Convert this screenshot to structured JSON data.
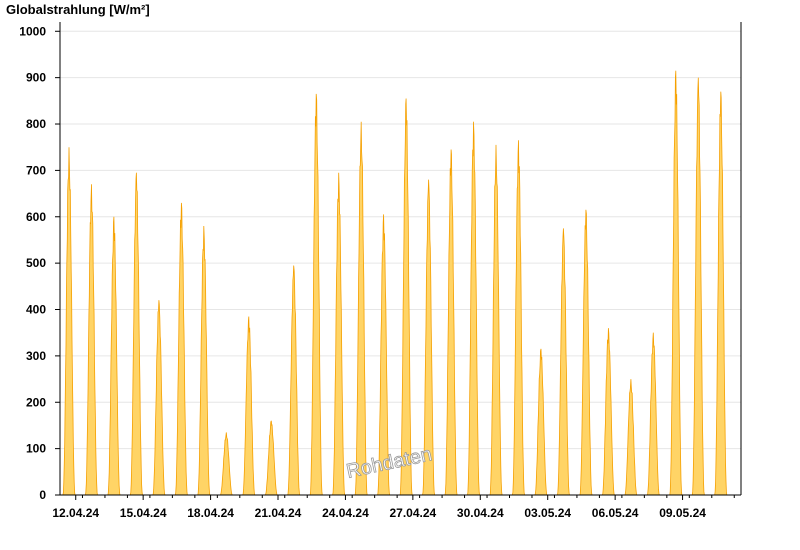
{
  "chart_data": {
    "type": "area",
    "title": "Globalstrahlung [W/m²]",
    "ylabel": "Globalstrahlung [W/m²]",
    "xlabel": "",
    "ylim": [
      0,
      1020
    ],
    "yticks": [
      0,
      100,
      200,
      300,
      400,
      500,
      600,
      700,
      800,
      900,
      1000
    ],
    "xtick_labels": [
      "12.04.24",
      "15.04.24",
      "18.04.24",
      "21.04.24",
      "24.04.24",
      "27.04.24",
      "30.04.24",
      "03.05.24",
      "06.05.24",
      "09.05.24"
    ],
    "xlim_days": [
      0,
      30.3
    ],
    "xtick_day_offsets": [
      0.7,
      3.7,
      6.7,
      9.7,
      12.7,
      15.7,
      18.7,
      21.7,
      24.7,
      27.7
    ],
    "grid": true,
    "watermark": "Rohdaten",
    "color_fill": "#ffd466",
    "color_line": "#f5a000",
    "series": [
      {
        "name": "",
        "daily_peaks": [
          {
            "day": "11.04.24",
            "peak": 750
          },
          {
            "day": "12.04.24",
            "peak": 670
          },
          {
            "day": "13.04.24",
            "peak": 600
          },
          {
            "day": "14.04.24",
            "peak": 695
          },
          {
            "day": "15.04.24",
            "peak": 420
          },
          {
            "day": "16.04.24",
            "peak": 630
          },
          {
            "day": "17.04.24",
            "peak": 580
          },
          {
            "day": "18.04.24",
            "peak": 135
          },
          {
            "day": "19.04.24",
            "peak": 385
          },
          {
            "day": "20.04.24",
            "peak": 160
          },
          {
            "day": "21.04.24",
            "peak": 495
          },
          {
            "day": "22.04.24",
            "peak": 865
          },
          {
            "day": "23.04.24",
            "peak": 695
          },
          {
            "day": "24.04.24",
            "peak": 805
          },
          {
            "day": "25.04.24",
            "peak": 605
          },
          {
            "day": "26.04.24",
            "peak": 855
          },
          {
            "day": "27.04.24",
            "peak": 680
          },
          {
            "day": "28.04.24",
            "peak": 745
          },
          {
            "day": "29.04.24",
            "peak": 805
          },
          {
            "day": "30.04.24",
            "peak": 755
          },
          {
            "day": "01.05.24",
            "peak": 765
          },
          {
            "day": "02.05.24",
            "peak": 315
          },
          {
            "day": "03.05.24",
            "peak": 575
          },
          {
            "day": "04.05.24",
            "peak": 615
          },
          {
            "day": "05.05.24",
            "peak": 360
          },
          {
            "day": "06.05.24",
            "peak": 250
          },
          {
            "day": "07.05.24",
            "peak": 350
          },
          {
            "day": "08.05.24",
            "peak": 915
          },
          {
            "day": "09.05.24",
            "peak": 900
          },
          {
            "day": "10.05.24",
            "peak": 870
          }
        ]
      }
    ]
  }
}
